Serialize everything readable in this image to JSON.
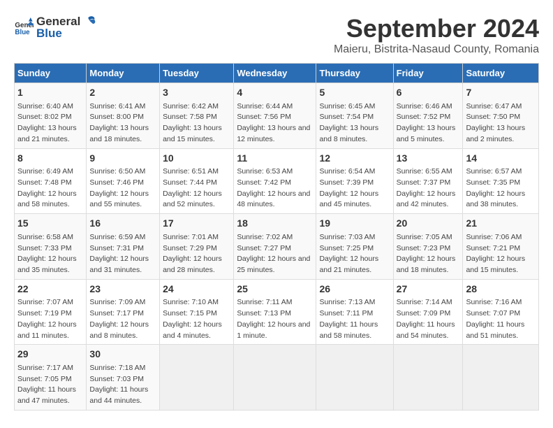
{
  "logo": {
    "text_general": "General",
    "text_blue": "Blue"
  },
  "title": "September 2024",
  "subtitle": "Maieru, Bistrita-Nasaud County, Romania",
  "headers": [
    "Sunday",
    "Monday",
    "Tuesday",
    "Wednesday",
    "Thursday",
    "Friday",
    "Saturday"
  ],
  "weeks": [
    [
      {
        "day": "1",
        "sunrise": "Sunrise: 6:40 AM",
        "sunset": "Sunset: 8:02 PM",
        "daylight": "Daylight: 13 hours and 21 minutes."
      },
      {
        "day": "2",
        "sunrise": "Sunrise: 6:41 AM",
        "sunset": "Sunset: 8:00 PM",
        "daylight": "Daylight: 13 hours and 18 minutes."
      },
      {
        "day": "3",
        "sunrise": "Sunrise: 6:42 AM",
        "sunset": "Sunset: 7:58 PM",
        "daylight": "Daylight: 13 hours and 15 minutes."
      },
      {
        "day": "4",
        "sunrise": "Sunrise: 6:44 AM",
        "sunset": "Sunset: 7:56 PM",
        "daylight": "Daylight: 13 hours and 12 minutes."
      },
      {
        "day": "5",
        "sunrise": "Sunrise: 6:45 AM",
        "sunset": "Sunset: 7:54 PM",
        "daylight": "Daylight: 13 hours and 8 minutes."
      },
      {
        "day": "6",
        "sunrise": "Sunrise: 6:46 AM",
        "sunset": "Sunset: 7:52 PM",
        "daylight": "Daylight: 13 hours and 5 minutes."
      },
      {
        "day": "7",
        "sunrise": "Sunrise: 6:47 AM",
        "sunset": "Sunset: 7:50 PM",
        "daylight": "Daylight: 13 hours and 2 minutes."
      }
    ],
    [
      {
        "day": "8",
        "sunrise": "Sunrise: 6:49 AM",
        "sunset": "Sunset: 7:48 PM",
        "daylight": "Daylight: 12 hours and 58 minutes."
      },
      {
        "day": "9",
        "sunrise": "Sunrise: 6:50 AM",
        "sunset": "Sunset: 7:46 PM",
        "daylight": "Daylight: 12 hours and 55 minutes."
      },
      {
        "day": "10",
        "sunrise": "Sunrise: 6:51 AM",
        "sunset": "Sunset: 7:44 PM",
        "daylight": "Daylight: 12 hours and 52 minutes."
      },
      {
        "day": "11",
        "sunrise": "Sunrise: 6:53 AM",
        "sunset": "Sunset: 7:42 PM",
        "daylight": "Daylight: 12 hours and 48 minutes."
      },
      {
        "day": "12",
        "sunrise": "Sunrise: 6:54 AM",
        "sunset": "Sunset: 7:39 PM",
        "daylight": "Daylight: 12 hours and 45 minutes."
      },
      {
        "day": "13",
        "sunrise": "Sunrise: 6:55 AM",
        "sunset": "Sunset: 7:37 PM",
        "daylight": "Daylight: 12 hours and 42 minutes."
      },
      {
        "day": "14",
        "sunrise": "Sunrise: 6:57 AM",
        "sunset": "Sunset: 7:35 PM",
        "daylight": "Daylight: 12 hours and 38 minutes."
      }
    ],
    [
      {
        "day": "15",
        "sunrise": "Sunrise: 6:58 AM",
        "sunset": "Sunset: 7:33 PM",
        "daylight": "Daylight: 12 hours and 35 minutes."
      },
      {
        "day": "16",
        "sunrise": "Sunrise: 6:59 AM",
        "sunset": "Sunset: 7:31 PM",
        "daylight": "Daylight: 12 hours and 31 minutes."
      },
      {
        "day": "17",
        "sunrise": "Sunrise: 7:01 AM",
        "sunset": "Sunset: 7:29 PM",
        "daylight": "Daylight: 12 hours and 28 minutes."
      },
      {
        "day": "18",
        "sunrise": "Sunrise: 7:02 AM",
        "sunset": "Sunset: 7:27 PM",
        "daylight": "Daylight: 12 hours and 25 minutes."
      },
      {
        "day": "19",
        "sunrise": "Sunrise: 7:03 AM",
        "sunset": "Sunset: 7:25 PM",
        "daylight": "Daylight: 12 hours and 21 minutes."
      },
      {
        "day": "20",
        "sunrise": "Sunrise: 7:05 AM",
        "sunset": "Sunset: 7:23 PM",
        "daylight": "Daylight: 12 hours and 18 minutes."
      },
      {
        "day": "21",
        "sunrise": "Sunrise: 7:06 AM",
        "sunset": "Sunset: 7:21 PM",
        "daylight": "Daylight: 12 hours and 15 minutes."
      }
    ],
    [
      {
        "day": "22",
        "sunrise": "Sunrise: 7:07 AM",
        "sunset": "Sunset: 7:19 PM",
        "daylight": "Daylight: 12 hours and 11 minutes."
      },
      {
        "day": "23",
        "sunrise": "Sunrise: 7:09 AM",
        "sunset": "Sunset: 7:17 PM",
        "daylight": "Daylight: 12 hours and 8 minutes."
      },
      {
        "day": "24",
        "sunrise": "Sunrise: 7:10 AM",
        "sunset": "Sunset: 7:15 PM",
        "daylight": "Daylight: 12 hours and 4 minutes."
      },
      {
        "day": "25",
        "sunrise": "Sunrise: 7:11 AM",
        "sunset": "Sunset: 7:13 PM",
        "daylight": "Daylight: 12 hours and 1 minute."
      },
      {
        "day": "26",
        "sunrise": "Sunrise: 7:13 AM",
        "sunset": "Sunset: 7:11 PM",
        "daylight": "Daylight: 11 hours and 58 minutes."
      },
      {
        "day": "27",
        "sunrise": "Sunrise: 7:14 AM",
        "sunset": "Sunset: 7:09 PM",
        "daylight": "Daylight: 11 hours and 54 minutes."
      },
      {
        "day": "28",
        "sunrise": "Sunrise: 7:16 AM",
        "sunset": "Sunset: 7:07 PM",
        "daylight": "Daylight: 11 hours and 51 minutes."
      }
    ],
    [
      {
        "day": "29",
        "sunrise": "Sunrise: 7:17 AM",
        "sunset": "Sunset: 7:05 PM",
        "daylight": "Daylight: 11 hours and 47 minutes."
      },
      {
        "day": "30",
        "sunrise": "Sunrise: 7:18 AM",
        "sunset": "Sunset: 7:03 PM",
        "daylight": "Daylight: 11 hours and 44 minutes."
      },
      null,
      null,
      null,
      null,
      null
    ]
  ]
}
